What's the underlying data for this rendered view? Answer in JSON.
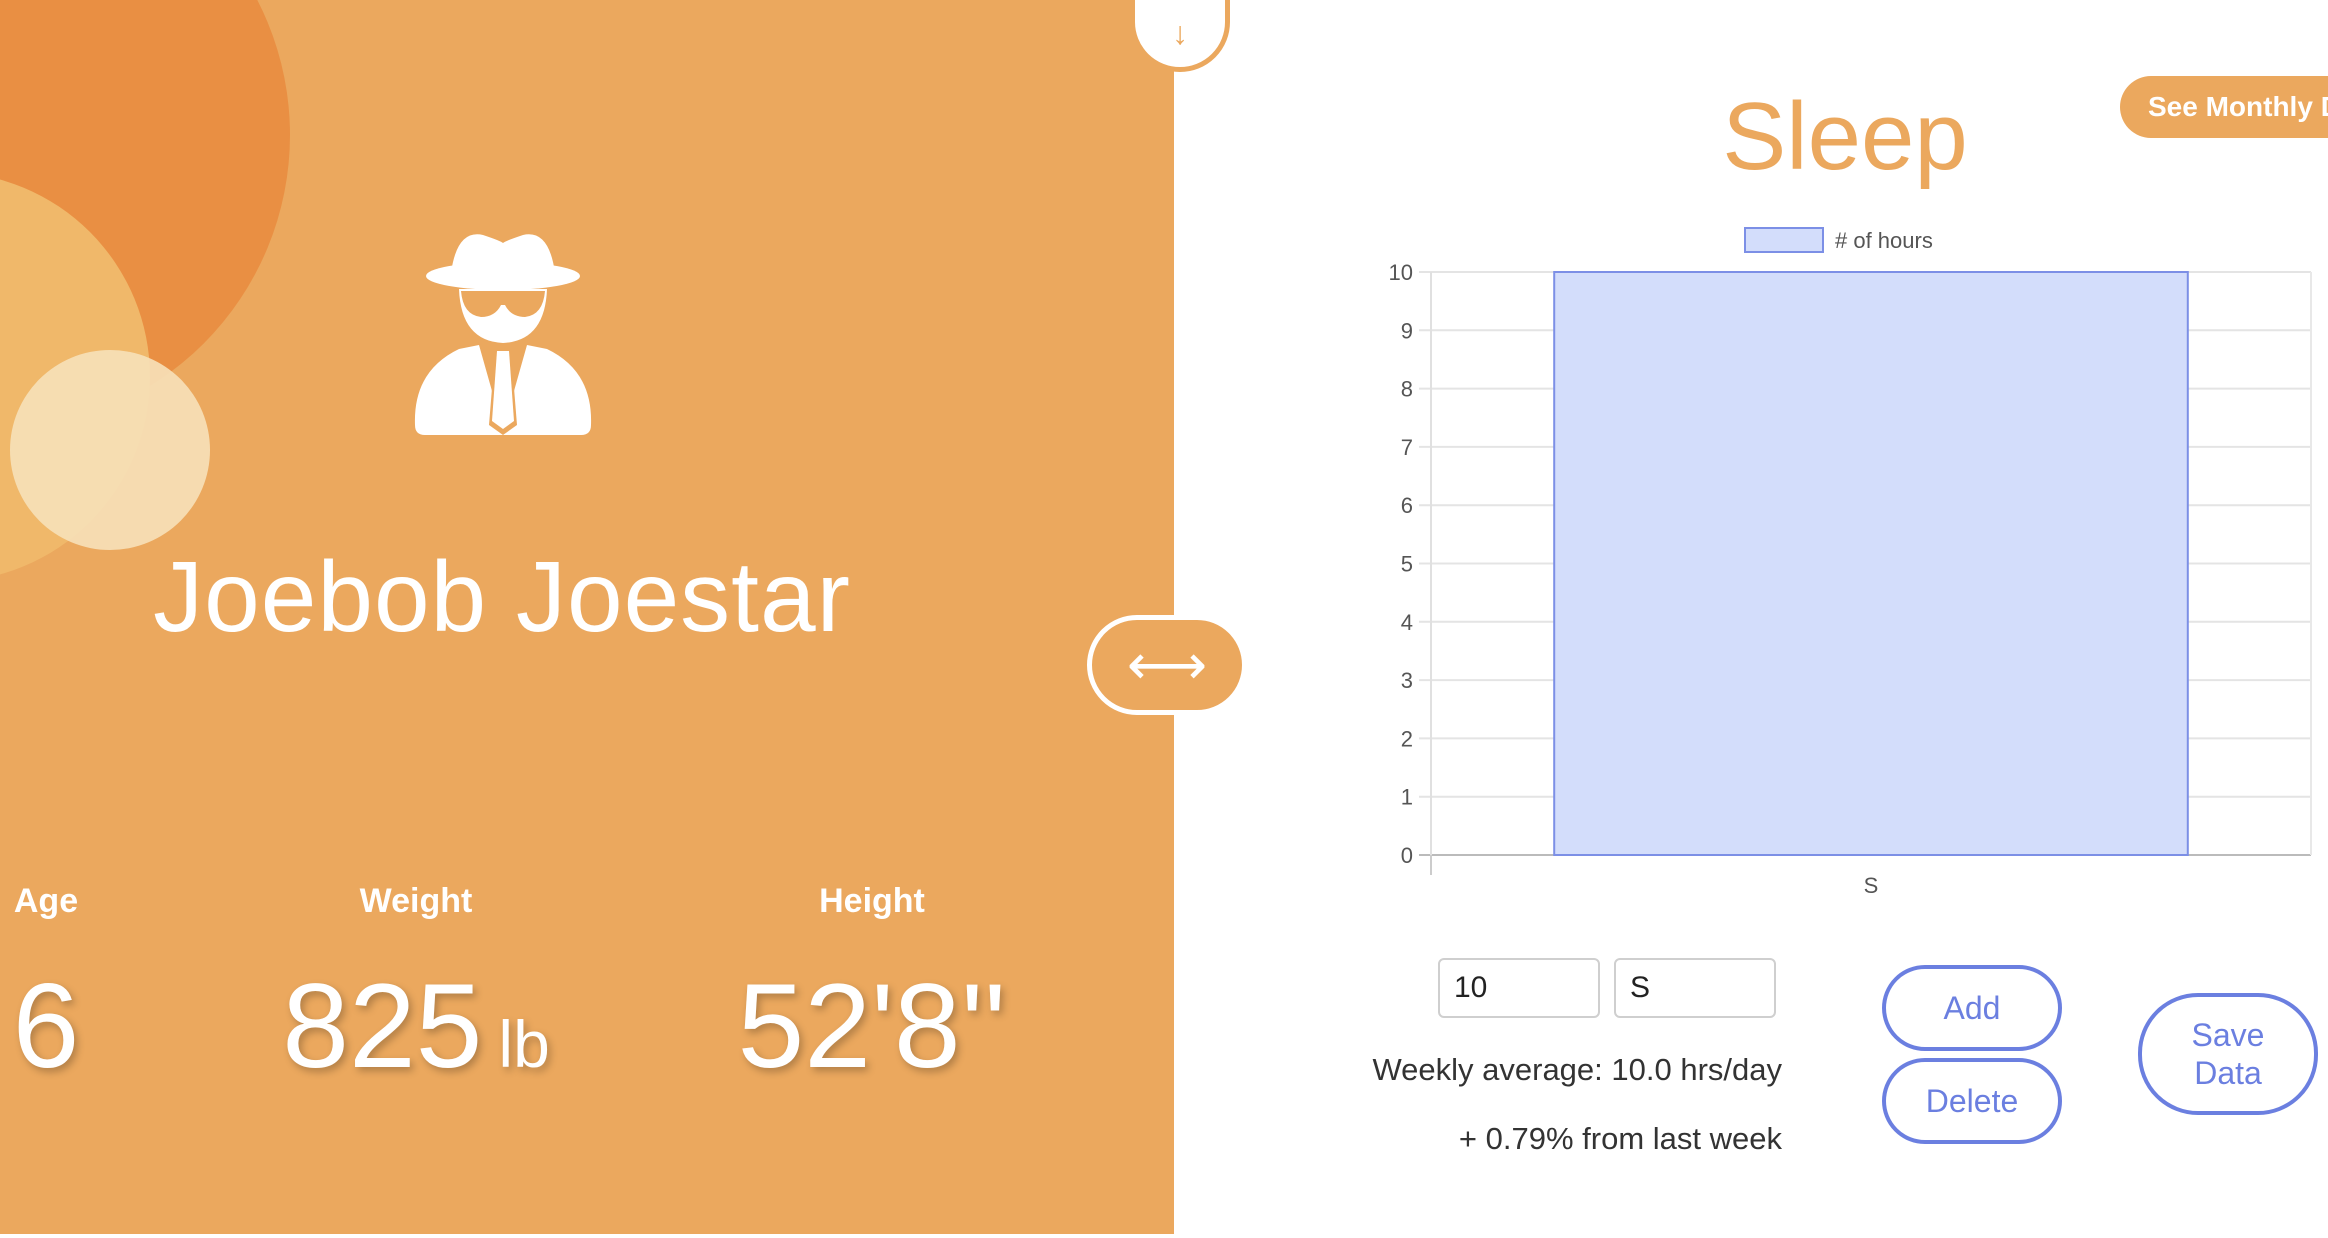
{
  "profile": {
    "name": "Joebob Joestar",
    "avatar_icon": "user-secret-icon",
    "stats": [
      {
        "label": "Age",
        "value": "6",
        "unit": ""
      },
      {
        "label": "Weight",
        "value": "825",
        "unit": "lb"
      },
      {
        "label": "Height",
        "value": "52'8''",
        "unit": ""
      }
    ]
  },
  "handles": {
    "top_icon": "↓",
    "middle_icon": "⟷"
  },
  "sleep": {
    "title": "Sleep",
    "monthly_button": "See Monthly D",
    "hours_input": "10",
    "day_input": "S",
    "add_label": "Add",
    "delete_label": "Delete",
    "save_label": "Save Data",
    "weekly_average": "Weekly average: 10.0 hrs/day",
    "change": "+ 0.79% from last week"
  },
  "colors": {
    "accent": "#eba85e",
    "bar_fill": "#d3ddfb",
    "bar_border": "#7c8fe6",
    "button": "#6b7fe0"
  },
  "chart_data": {
    "type": "bar",
    "categories": [
      "S"
    ],
    "series": [
      {
        "name": "# of hours",
        "values": [
          10
        ]
      }
    ],
    "ylim": [
      0,
      10
    ],
    "yticks": [
      "0",
      "1",
      "2",
      "3",
      "4",
      "5",
      "6",
      "7",
      "8",
      "9",
      "10"
    ],
    "grid": true,
    "legend": "top-center"
  }
}
